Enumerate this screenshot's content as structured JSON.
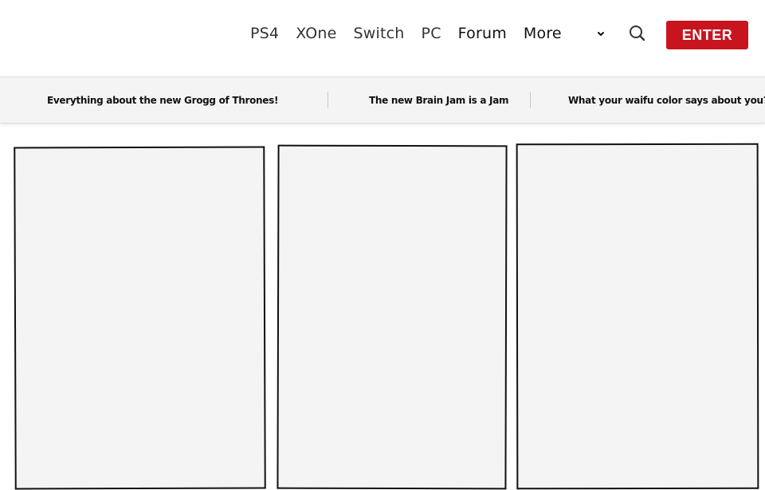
{
  "nav": {
    "items": [
      {
        "label": "PS4"
      },
      {
        "label": "XOne"
      },
      {
        "label": "Switch"
      },
      {
        "label": "PC"
      },
      {
        "label": "Forum"
      },
      {
        "label": "More"
      }
    ],
    "more_chevron": "⌄",
    "search_icon": "search-icon",
    "enter_label": "ENTER"
  },
  "colors": {
    "accent": "#c8141e",
    "headline_bar_bg": "#f4f4f4",
    "card_bg": "#f4f4f4"
  },
  "headlines": [
    {
      "text": "Everything about the new Grogg of Thrones!"
    },
    {
      "text": "The new Brain Jam is a Jam"
    },
    {
      "text": "What your waifu color says about you?"
    }
  ],
  "cards": [
    {
      "label": ""
    },
    {
      "label": ""
    },
    {
      "label": ""
    }
  ]
}
